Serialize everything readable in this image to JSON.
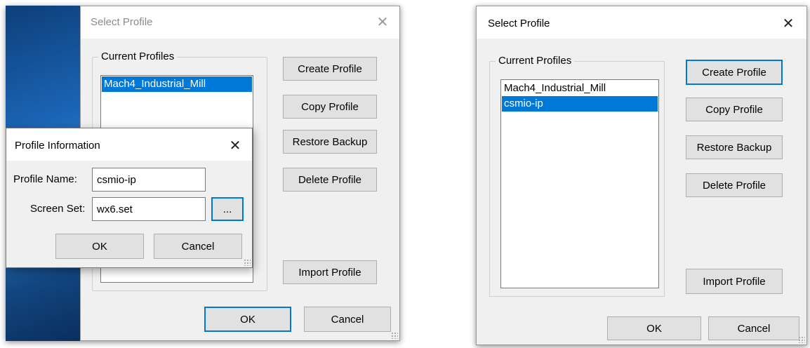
{
  "left_screenshot": {
    "select_profile": {
      "title": "Select Profile",
      "close_glyph": "✕",
      "group_label": "Current Profiles",
      "profiles": [
        {
          "name": "Mach4_Industrial_Mill",
          "selected": true
        }
      ],
      "buttons": {
        "create": "Create Profile",
        "copy": "Copy Profile",
        "restore": "Restore Backup",
        "delete": "Delete Profile",
        "import": "Import Profile",
        "ok": "OK",
        "cancel": "Cancel"
      }
    },
    "profile_information": {
      "title": "Profile Information",
      "close_glyph": "✕",
      "profile_name_label": "Profile Name:",
      "profile_name_value": "csmio-ip",
      "screen_set_label": "Screen Set:",
      "screen_set_value": "wx6.set",
      "browse_label": "...",
      "ok": "OK",
      "cancel": "Cancel"
    }
  },
  "right_screenshot": {
    "select_profile": {
      "title": "Select Profile",
      "close_glyph": "✕",
      "group_label": "Current Profiles",
      "profiles": [
        {
          "name": "Mach4_Industrial_Mill",
          "selected": false
        },
        {
          "name": "csmio-ip",
          "selected": true
        }
      ],
      "buttons": {
        "create": "Create Profile",
        "copy": "Copy Profile",
        "restore": "Restore Backup",
        "delete": "Delete Profile",
        "import": "Import Profile",
        "ok": "OK",
        "cancel": "Cancel"
      }
    }
  },
  "colors": {
    "selection": "#0078d7",
    "dialog_bg": "#f0f0f0",
    "button_bg": "#e1e1e1"
  }
}
